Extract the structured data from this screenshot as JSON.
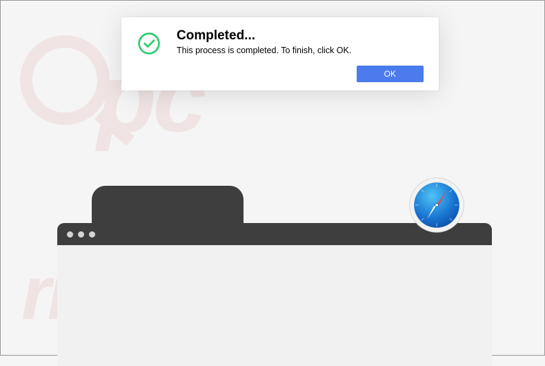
{
  "dialog": {
    "title": "Completed...",
    "message": "This process is completed. To finish, click OK.",
    "ok_label": "OK"
  },
  "watermark": {
    "top_text": "pc",
    "bottom_text": "risk.com"
  },
  "colors": {
    "dialog_button": "#4b7bec",
    "check_icon": "#2ecc71",
    "browser_chrome": "#3e3e3e",
    "watermark": "#c0504d"
  }
}
